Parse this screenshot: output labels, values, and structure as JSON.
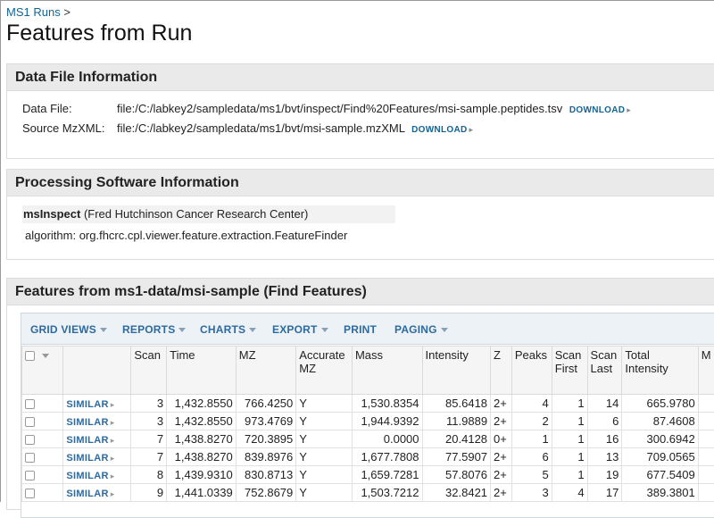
{
  "breadcrumb": {
    "link": "MS1 Runs",
    "sep": ">"
  },
  "page_title": "Features from Run",
  "data_file_panel": {
    "title": "Data File Information",
    "data_file_label": "Data File:",
    "data_file_value": "file:/C:/labkey2/sampledata/ms1/bvt/inspect/Find%20Features/msi-sample.peptides.tsv",
    "source_label": "Source MzXML:",
    "source_value": "file:/C:/labkey2/sampledata/ms1/bvt/msi-sample.mzXML",
    "download_label": "DOWNLOAD"
  },
  "software_panel": {
    "title": "Processing Software Information",
    "software_name": "msInspect",
    "software_org": "(Fred Hutchinson Cancer Research Center)",
    "algorithm": "algorithm: org.fhcrc.cpl.viewer.feature.extraction.FeatureFinder"
  },
  "features_panel": {
    "title": "Features from ms1-data/msi-sample (Find Features)",
    "toolbar": [
      "GRID VIEWS",
      "REPORTS",
      "CHARTS",
      "EXPORT",
      "PRINT",
      "PAGING"
    ],
    "columns": {
      "scan": "Scan",
      "time": "Time",
      "mz": "MZ",
      "accurate_mz_1": "Accurate",
      "accurate_mz_2": "MZ",
      "mass": "Mass",
      "intensity": "Intensity",
      "z": "Z",
      "peaks": "Peaks",
      "scan_first_1": "Scan",
      "scan_first_2": "First",
      "scan_last_1": "Scan",
      "scan_last_2": "Last",
      "total_intensity_1": "Total",
      "total_intensity_2": "Intensity",
      "extra": "M"
    },
    "similar_label": "SIMILAR",
    "rows": [
      {
        "scan": "3",
        "time": "1,432.8550",
        "mz": "766.4250",
        "amz": "Y",
        "mass": "1,530.8354",
        "intensity": "85.6418",
        "z": "2+",
        "peaks": "4",
        "first": "1",
        "last": "14",
        "total": "665.9780"
      },
      {
        "scan": "3",
        "time": "1,432.8550",
        "mz": "973.4769",
        "amz": "Y",
        "mass": "1,944.9392",
        "intensity": "11.9889",
        "z": "2+",
        "peaks": "2",
        "first": "1",
        "last": "6",
        "total": "87.4608"
      },
      {
        "scan": "7",
        "time": "1,438.8270",
        "mz": "720.3895",
        "amz": "Y",
        "mass": "0.0000",
        "intensity": "20.4128",
        "z": "0+",
        "peaks": "1",
        "first": "1",
        "last": "16",
        "total": "300.6942"
      },
      {
        "scan": "7",
        "time": "1,438.8270",
        "mz": "839.8976",
        "amz": "Y",
        "mass": "1,677.7808",
        "intensity": "77.5907",
        "z": "2+",
        "peaks": "6",
        "first": "1",
        "last": "13",
        "total": "709.0565"
      },
      {
        "scan": "8",
        "time": "1,439.9310",
        "mz": "830.8713",
        "amz": "Y",
        "mass": "1,659.7281",
        "intensity": "57.8076",
        "z": "2+",
        "peaks": "5",
        "first": "1",
        "last": "19",
        "total": "677.5409"
      },
      {
        "scan": "9",
        "time": "1,441.0339",
        "mz": "752.8679",
        "amz": "Y",
        "mass": "1,503.7212",
        "intensity": "32.8421",
        "z": "2+",
        "peaks": "3",
        "first": "4",
        "last": "17",
        "total": "389.3801"
      }
    ]
  }
}
